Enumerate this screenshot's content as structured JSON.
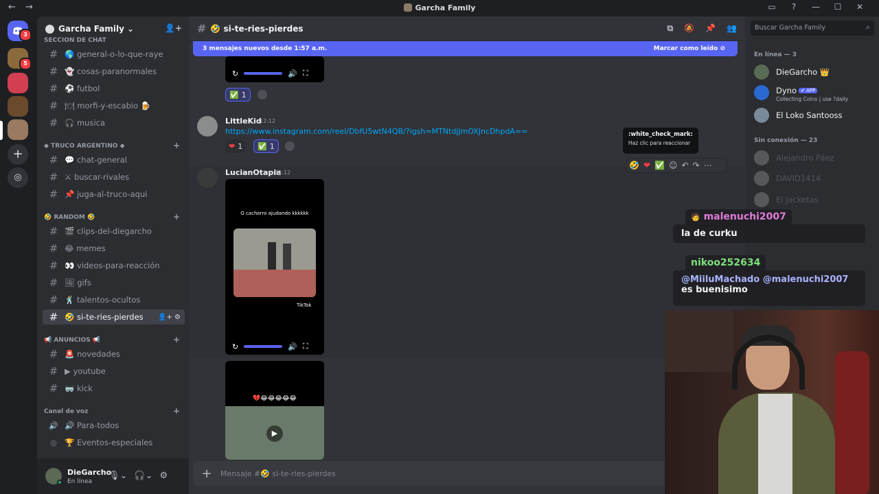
{
  "window": {
    "title": "Garcha Family",
    "nav_back": "←",
    "nav_fwd": "→",
    "btn_inbox": "▭",
    "btn_help": "?",
    "btn_min": "—",
    "btn_max": "☐",
    "btn_close": "✕"
  },
  "rail": {
    "badge_top": "3",
    "badge_second": "5"
  },
  "sidebar": {
    "guild_name": "Garcha Family",
    "guild_chevron": "⌄",
    "cat_chat": "SECCION DE CHAT",
    "cat_truco": "◆ TRUCO ARGENTINO ◆",
    "cat_random": "🤣 RANDOM 🤣",
    "cat_anuncios": "📢 ANUNCIOS 📢",
    "cat_voz": "Canal de voz",
    "ch_general": "🌎 general-o-lo-que-raye",
    "ch_paranormal": "👻 cosas-paranormales",
    "ch_futbol": "⚽ futbol",
    "ch_morfi": "🍽 morfi-y-escabio 🍺",
    "ch_musica": "🎧 musica",
    "ch_chatgeneral": "💬 chat-general",
    "ch_buscar": "⚔ buscar-rivales",
    "ch_juga": "📌 juga-al-truco-aqui",
    "ch_clips": "🎬 clips-del-diegarcho",
    "ch_memes": "😂 memes",
    "ch_videos": "👀 videos-para-reacción",
    "ch_gifs": "🖼 gifs",
    "ch_talentos": "🕺 talentos-ocultos",
    "ch_siteries": "🤣 si-te-ries-pierdes",
    "ch_novedades": "🚨 novedades",
    "ch_youtube": "▶ youtube",
    "ch_kick": "🥽 kick",
    "ch_paratodos": "🔊 Para-todos",
    "ch_eventos": "🏆 Eventos-especiales"
  },
  "user": {
    "name": "DieGarcho",
    "status": "En línea"
  },
  "chat": {
    "channel": "🤣 si-te-ries-pierdes",
    "banner_text": "3 mensajes nuevos desde 1:57 a.m.",
    "banner_action": "Marcar como leído",
    "msg1_react_emoji": "✅",
    "msg1_react_count": "1",
    "msg2_author": "LittleKid",
    "msg2_time": "12:12",
    "msg2_link": "https://www.instagram.com/reel/DbfU5wtN4QB/?igsh=MTNtdjJmOXJncDhpdA==",
    "msg2_react1_emoji": "❤",
    "msg2_react1_count": "1",
    "msg2_react2_emoji": "✅",
    "msg2_react2_count": "1",
    "msg3_author": "LucianOtapia",
    "msg3_time": "12:12",
    "video1_caption": "O cachorro ajudando kkkkkk",
    "video1_tag": "TikTok",
    "video2_caption": "💔😂😂😂😂😂",
    "tooltip_title": ":white_check_mark:",
    "tooltip_sub": "Haz clic para reaccionar",
    "composer_placeholder": "Mensaje #🤣 si-te-ries-pierdes"
  },
  "members": {
    "search_placeholder": "Buscar Garcha Family",
    "online_header": "En línea — 3",
    "offline_header": "Sin conexión — 23",
    "m1": "DieGarcho 👑",
    "m2": "Dyno",
    "m2_badge": "✔ APP",
    "m2_sub": "Collecting Coins | use ?daily",
    "m3": "El Loko Santooss",
    "off1": "Alejandro Páez",
    "off2": "DAVID1414",
    "off3": "El Jacketas"
  },
  "overlay": {
    "name1": "malenuchi2007",
    "msg1": "la de curku",
    "name2": "nikoo252634",
    "msg2_mentions": "@MiiluMachado @malenuchi2007",
    "msg2_text": "es buenisimo",
    "name1_color": "#e07ad8",
    "name2_color": "#7ee07a"
  }
}
